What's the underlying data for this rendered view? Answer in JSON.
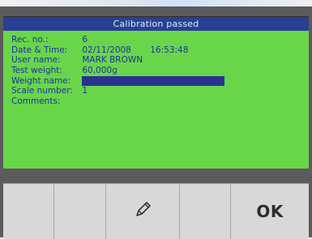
{
  "title": "Calibration passed",
  "fields": [
    {
      "label": "Rec. no.:",
      "value": "6"
    },
    {
      "label": "Date & Time:",
      "date": "02/11/2008",
      "time": "16:53:48"
    },
    {
      "label": "User name:",
      "value": "MARK BROWN"
    },
    {
      "label": "Test weight:",
      "value": "60,000g"
    },
    {
      "label": "Weight name:",
      "value": ""
    },
    {
      "label": "Scale number:",
      "value": "1"
    },
    {
      "label": "Comments:",
      "value": ""
    }
  ],
  "softkeys": [
    {
      "label": ""
    },
    {
      "label": ""
    },
    {
      "icon": "pencil-icon"
    },
    {
      "label": ""
    },
    {
      "label": "OK"
    }
  ],
  "colors": {
    "screen_background": "#69d64a",
    "title_bar": "#2b3f93",
    "text": "#1f2fa2",
    "input_bar": "#2b318f"
  }
}
